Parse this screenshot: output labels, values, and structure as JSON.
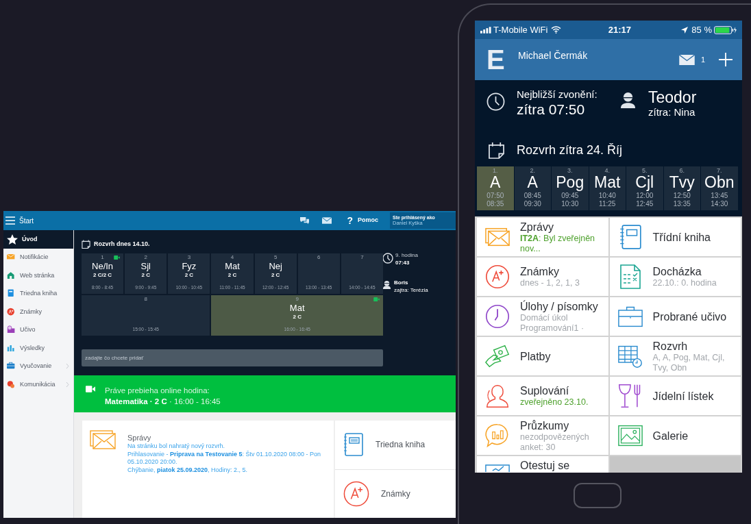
{
  "desktop": {
    "header": {
      "title": "Štart",
      "help_mark": "?",
      "help": "Pomoc",
      "login_label": "Ste prihlásený ako",
      "user": "Daniel Kyška"
    },
    "sidebar": [
      {
        "label": "Úvod",
        "selected": true,
        "has_submenu": false
      },
      {
        "label": "Notifikácie",
        "selected": false,
        "has_submenu": false
      },
      {
        "label": "Web stránka",
        "selected": false,
        "has_submenu": false
      },
      {
        "label": "Triedna kniha",
        "selected": false,
        "has_submenu": false
      },
      {
        "label": "Známky",
        "selected": false,
        "has_submenu": false
      },
      {
        "label": "Učivo",
        "selected": false,
        "has_submenu": false
      },
      {
        "label": "Výsledky",
        "selected": false,
        "has_submenu": false
      },
      {
        "label": "Vyučovanie",
        "selected": false,
        "has_submenu": true
      },
      {
        "label": "Komunikácia",
        "selected": false,
        "has_submenu": true
      }
    ],
    "timetable": {
      "title": "Rozvrh dnes 14.10.",
      "rows": [
        [
          {
            "num": "1",
            "subject": "Ne/In",
            "class": "2 C/2 C",
            "time": "8:00 - 8:45",
            "online": true,
            "current": false
          },
          {
            "num": "2",
            "subject": "Sjl",
            "class": "2 C",
            "time": "9:00 - 9:45",
            "online": false,
            "current": false
          },
          {
            "num": "3",
            "subject": "Fyz",
            "class": "2 C",
            "time": "10:00 - 10:45",
            "online": false,
            "current": false
          },
          {
            "num": "4",
            "subject": "Mat",
            "class": "2 C",
            "time": "11:00 - 11:45",
            "online": false,
            "current": false
          },
          {
            "num": "5",
            "subject": "Nej",
            "class": "2 C",
            "time": "12:00 - 12:45",
            "online": false,
            "current": false
          },
          {
            "num": "6",
            "time": "13:00 - 13:45",
            "online": false,
            "current": false
          },
          {
            "num": "7",
            "time": "14:00 - 14:45",
            "online": false,
            "current": false
          }
        ],
        [
          {
            "num": "8",
            "time": "15:00 - 15:45",
            "online": false,
            "current": false,
            "colspan": 3
          },
          {
            "num": "9",
            "subject": "Mat",
            "class": "2 C",
            "time": "16:00 - 16:45",
            "online": true,
            "current": true,
            "colspan": 4
          }
        ]
      ]
    },
    "next_bell": {
      "lesson": "9. hodina",
      "time": "07:43"
    },
    "teacher": {
      "name": "Boris",
      "tomorrow": "zajtra: Terézia"
    },
    "add_field": {
      "placeholder": "zadajte čo chcete pridať"
    },
    "online_banner": {
      "title": "Práve prebieha online hodina:",
      "detail": "**Matematika · 2 C** · 16:00 - 16:45"
    },
    "messages": {
      "title": "Správy",
      "lines": [
        "Na stránku bol nahratý nový rozvrh.",
        "Prihlasovanie - **Priprava na Testovanie 5**: Štv 01.10.2020 08:00 - Pon 05.10.2020 20:00.",
        "Chýbanie, **piatok 25.09.2020**, Hodiny: 2., 5."
      ]
    },
    "tiles": [
      "Triedna kniha",
      "Známky"
    ]
  },
  "phone": {
    "status_bar": {
      "carrier": "T-Mobile WiFi",
      "time": "21:17",
      "battery": "85 %"
    },
    "header": {
      "logo": "E",
      "user": "Michael Čermák",
      "unread": "1"
    },
    "next_bell": {
      "label": "Nejbližší zvonění:",
      "time": "zítra 07:50"
    },
    "teacher": {
      "name": "Teodor",
      "tomorrow": "zítra: Nina"
    },
    "timetable": {
      "title": "Rozvrh zítra 24. Říj",
      "lessons": [
        {
          "num": "1.",
          "subject": "A",
          "start": "07:50",
          "end": "08:35",
          "selected": true
        },
        {
          "num": "2.",
          "subject": "A",
          "start": "08:45",
          "end": "09:30",
          "selected": false
        },
        {
          "num": "3.",
          "subject": "Pog",
          "start": "09:45",
          "end": "10:30",
          "selected": false
        },
        {
          "num": "4.",
          "subject": "Mat",
          "start": "10:40",
          "end": "11:25",
          "selected": false
        },
        {
          "num": "5.",
          "subject": "Cjl",
          "start": "12:00",
          "end": "12:45",
          "selected": false
        },
        {
          "num": "6.",
          "subject": "Tvy",
          "start": "12:50",
          "end": "13:35",
          "selected": false
        },
        {
          "num": "7.",
          "subject": "Obn",
          "start": "13:45",
          "end": "14:30",
          "selected": false
        }
      ]
    },
    "tile_rows": [
      [
        {
          "title": "Zprávy",
          "subtitle": "**IT2A**: Byl zveřejněn nov...",
          "highlight": true
        },
        {
          "title": "Třídní kniha"
        }
      ],
      [
        {
          "title": "Známky",
          "subtitle": "dnes - 1, 2, 1, 3",
          "highlight": false
        },
        {
          "title": "Docházka",
          "subtitle": "22.10.: 0. hodina",
          "highlight": false
        }
      ],
      [
        {
          "title": "Úlohy / písomky",
          "subtitle": "Domácí úkol Programování1 ·",
          "highlight": false
        },
        {
          "title": "Probrané učivo"
        }
      ],
      [
        {
          "title": "Platby"
        },
        {
          "title": "Rozvrh",
          "subtitle": "A, A, Pog, Mat, Cjl, Tvy, Obn",
          "highlight": false
        }
      ],
      [
        {
          "title": "Suplování",
          "subtitle": "zveřejněno 23.10.",
          "highlight": true
        },
        {
          "title": "Jídelní lístek"
        }
      ],
      [
        {
          "title": "Průzkumy",
          "subtitle": "nezodpovězených anket: 30",
          "highlight": false
        },
        {
          "title": "Galerie"
        }
      ],
      [
        {
          "title": "Otestuj se"
        }
      ]
    ]
  }
}
